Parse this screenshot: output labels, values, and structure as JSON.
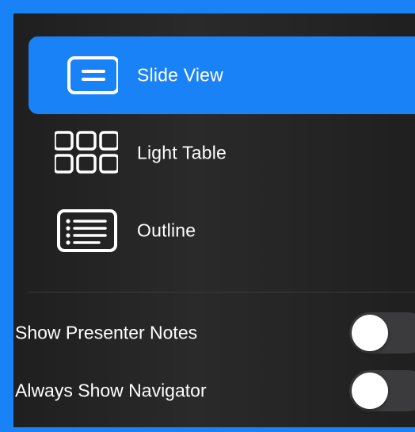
{
  "view_options": [
    {
      "label": "Slide View",
      "icon": "slide-view-icon",
      "selected": true
    },
    {
      "label": "Light Table",
      "icon": "light-table-icon",
      "selected": false
    },
    {
      "label": "Outline",
      "icon": "outline-icon",
      "selected": false
    }
  ],
  "toggles": [
    {
      "label": "Show Presenter Notes",
      "on": false
    },
    {
      "label": "Always Show Navigator",
      "on": false
    }
  ],
  "colors": {
    "accent": "#1a82f7",
    "panel": "#232323",
    "switch_off": "#3b3b3d"
  }
}
